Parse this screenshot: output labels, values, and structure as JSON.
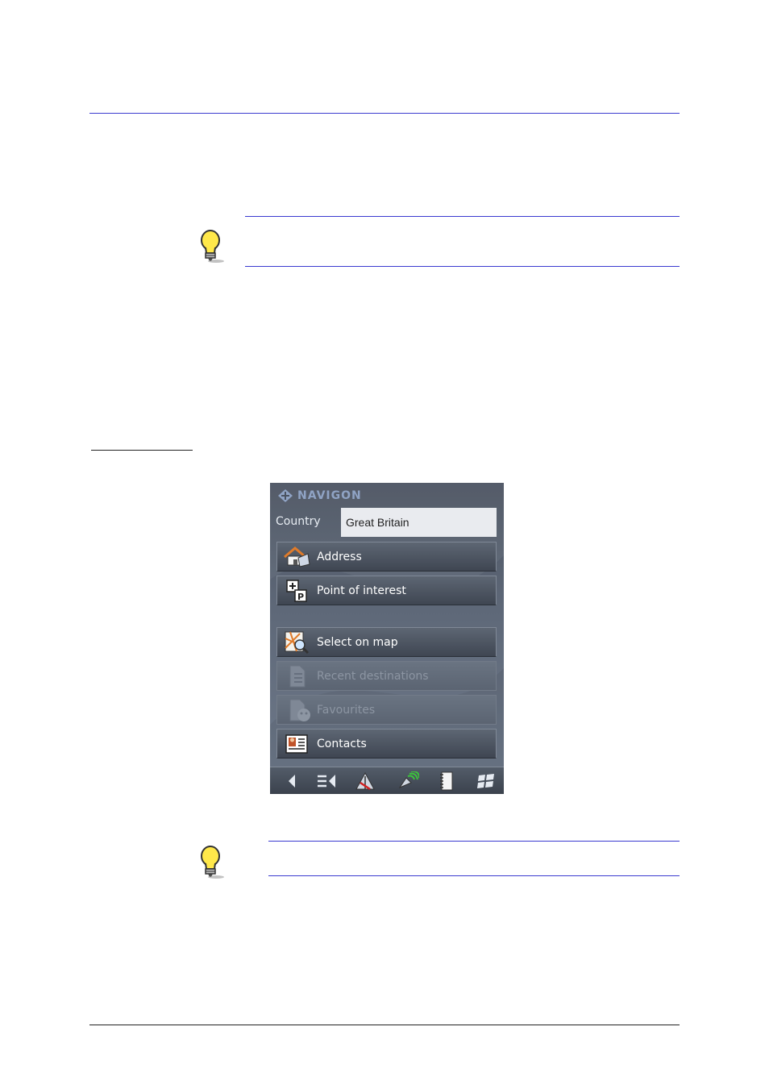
{
  "logo": {
    "text": "NAVIGON"
  },
  "country": {
    "label": "Country",
    "value": "Great Britain"
  },
  "menu": [
    {
      "label": "Address",
      "icon": "house-icon",
      "enabled": true
    },
    {
      "label": "Point of interest",
      "icon": "poi-icon",
      "enabled": true
    },
    {
      "label": "Select on map",
      "icon": "map-search-icon",
      "enabled": true
    },
    {
      "label": "Recent destinations",
      "icon": "recent-destinations-icon",
      "enabled": false
    },
    {
      "label": "Favourites",
      "icon": "favourites-icon",
      "enabled": false
    },
    {
      "label": "Contacts",
      "icon": "contacts-icon",
      "enabled": true
    }
  ],
  "toolbar": [
    "back-icon",
    "menu-icon",
    "route-icon",
    "gps-icon",
    "notebook-icon",
    "windows-icon"
  ],
  "colors": {
    "rule": "#3a3ad0",
    "device_bg": "#5e6878",
    "field_bg": "#e9ebef"
  }
}
